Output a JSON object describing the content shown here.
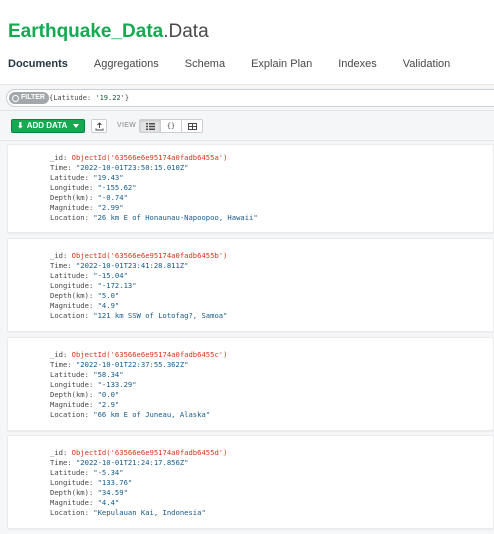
{
  "namespace": {
    "database": "Earthquake_Data",
    "separator": ".",
    "collection": "Data"
  },
  "tabs": [
    {
      "label": "Documents",
      "active": true
    },
    {
      "label": "Aggregations",
      "active": false
    },
    {
      "label": "Schema",
      "active": false
    },
    {
      "label": "Explain Plan",
      "active": false
    },
    {
      "label": "Indexes",
      "active": false
    },
    {
      "label": "Validation",
      "active": false
    }
  ],
  "filter": {
    "pill_label": "FILTER",
    "query_prefix": "{Latitude: ",
    "query_value": "'19.22'",
    "query_suffix": "}"
  },
  "toolbar": {
    "add_data_label": "ADD DATA",
    "view_label": "VIEW",
    "view_json_glyph": "{}"
  },
  "colors": {
    "brand_green": "#13aa52",
    "object_id": "#d9331a",
    "string_value": "#145a8c"
  },
  "documents": [
    {
      "id_key": "_id:",
      "id_value": "ObjectId('63566e6e95174a0fadb6455a')",
      "fields": [
        {
          "key": "Time:",
          "value": "\"2022-10-01T23:50:15.010Z\""
        },
        {
          "key": "Latitude:",
          "value": "\"19.43\""
        },
        {
          "key": "Longitude:",
          "value": "\"-155.62\""
        },
        {
          "key": "Depth(km):",
          "value": "\"-0.74\""
        },
        {
          "key": "Magnitude:",
          "value": "\"2.99\""
        },
        {
          "key": "Location:",
          "value": "\"26 km E of Honaunau-Napoopoo, Hawaii\""
        }
      ]
    },
    {
      "id_key": "_id:",
      "id_value": "ObjectId('63566e6e95174a0fadb6455b')",
      "fields": [
        {
          "key": "Time:",
          "value": "\"2022-10-01T23:41:28.811Z\""
        },
        {
          "key": "Latitude:",
          "value": "\"-15.04\""
        },
        {
          "key": "Longitude:",
          "value": "\"-172.13\""
        },
        {
          "key": "Depth(km):",
          "value": "\"5.0\""
        },
        {
          "key": "Magnitude:",
          "value": "\"4.9\""
        },
        {
          "key": "Location:",
          "value": "\"121 km SSW of Lotofag?, Samoa\""
        }
      ]
    },
    {
      "id_key": "_id:",
      "id_value": "ObjectId('63566e6e95174a0fadb6455c')",
      "fields": [
        {
          "key": "Time:",
          "value": "\"2022-10-01T22:37:55.362Z\""
        },
        {
          "key": "Latitude:",
          "value": "\"58.34\""
        },
        {
          "key": "Longitude:",
          "value": "\"-133.29\""
        },
        {
          "key": "Depth(km):",
          "value": "\"0.0\""
        },
        {
          "key": "Magnitude:",
          "value": "\"2.9\""
        },
        {
          "key": "Location:",
          "value": "\"66 km E of Juneau, Alaska\""
        }
      ]
    },
    {
      "id_key": "_id:",
      "id_value": "ObjectId('63566e6e95174a0fadb6455d')",
      "fields": [
        {
          "key": "Time:",
          "value": "\"2022-10-01T21:24:17.856Z\""
        },
        {
          "key": "Latitude:",
          "value": "\"-5.34\""
        },
        {
          "key": "Longitude:",
          "value": "\"133.76\""
        },
        {
          "key": "Depth(km):",
          "value": "\"34.59\""
        },
        {
          "key": "Magnitude:",
          "value": "\"4.4\""
        },
        {
          "key": "Location:",
          "value": "\"Kepulauan Kai, Indonesia\""
        }
      ]
    }
  ]
}
